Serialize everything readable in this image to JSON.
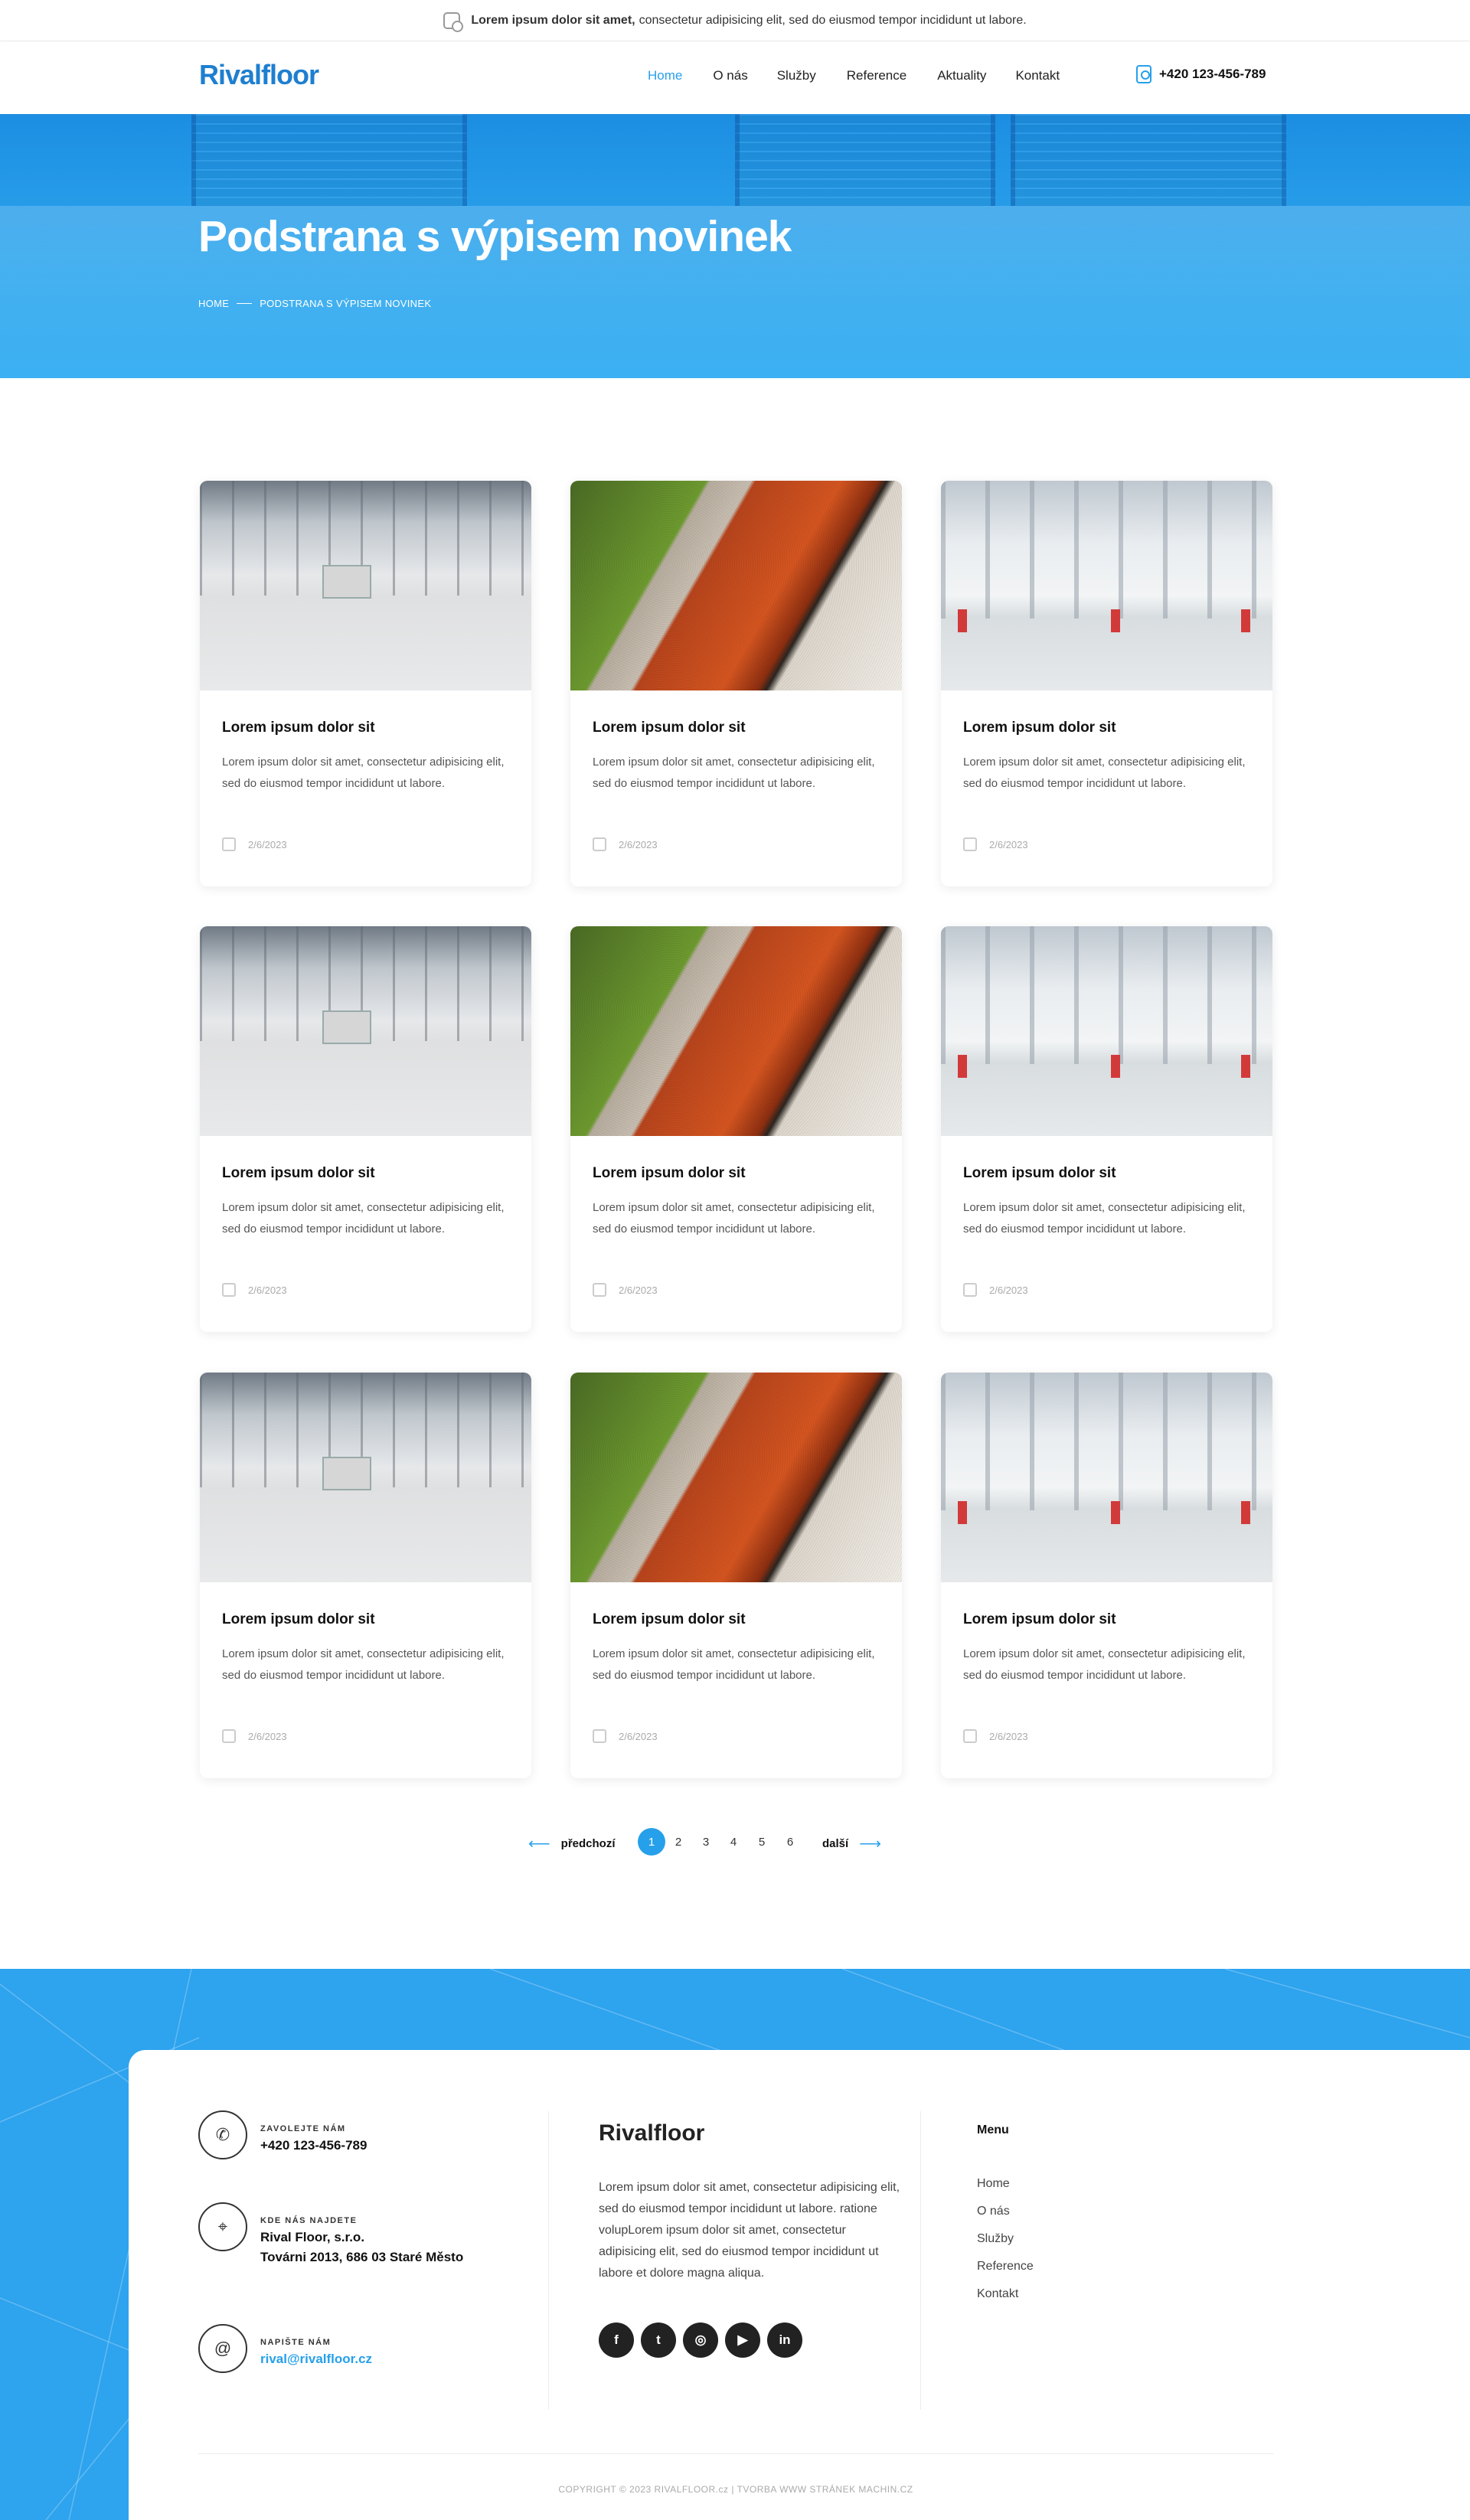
{
  "topbar": {
    "bold": "Lorem ipsum dolor sit amet,",
    "text": "consectetur adipisicing elit, sed do eiusmod tempor incididunt ut labore."
  },
  "header": {
    "logo": "Rivalfloor",
    "nav": [
      "Home",
      "O nás",
      "Služby",
      "Reference",
      "Aktuality",
      "Kontakt"
    ],
    "phone": "+420 123-456-789"
  },
  "hero": {
    "title": "Podstrana s výpisem novinek",
    "breadcrumb": [
      "HOME",
      "PODSTRANA S VÝPISEM NOVINEK"
    ]
  },
  "posts": [
    {
      "title": "Lorem ipsum dolor sit",
      "text": "Lorem ipsum dolor sit amet, consectetur adipisicing elit, sed do eiusmod tempor incididunt ut labore.",
      "date": "2/6/2023"
    },
    {
      "title": "Lorem ipsum dolor sit",
      "text": "Lorem ipsum dolor sit amet, consectetur adipisicing elit, sed do eiusmod tempor incididunt ut labore.",
      "date": "2/6/2023"
    },
    {
      "title": "Lorem ipsum dolor sit",
      "text": "Lorem ipsum dolor sit amet, consectetur adipisicing elit, sed do eiusmod tempor incididunt ut labore.",
      "date": "2/6/2023"
    },
    {
      "title": "Lorem ipsum dolor sit",
      "text": "Lorem ipsum dolor sit amet, consectetur adipisicing elit, sed do eiusmod tempor incididunt ut labore.",
      "date": "2/6/2023"
    },
    {
      "title": "Lorem ipsum dolor sit",
      "text": "Lorem ipsum dolor sit amet, consectetur adipisicing elit, sed do eiusmod tempor incididunt ut labore.",
      "date": "2/6/2023"
    },
    {
      "title": "Lorem ipsum dolor sit",
      "text": "Lorem ipsum dolor sit amet, consectetur adipisicing elit, sed do eiusmod tempor incididunt ut labore.",
      "date": "2/6/2023"
    },
    {
      "title": "Lorem ipsum dolor sit",
      "text": "Lorem ipsum dolor sit amet, consectetur adipisicing elit, sed do eiusmod tempor incididunt ut labore.",
      "date": "2/6/2023"
    },
    {
      "title": "Lorem ipsum dolor sit",
      "text": "Lorem ipsum dolor sit amet, consectetur adipisicing elit, sed do eiusmod tempor incididunt ut labore.",
      "date": "2/6/2023"
    },
    {
      "title": "Lorem ipsum dolor sit",
      "text": "Lorem ipsum dolor sit amet, consectetur adipisicing elit, sed do eiusmod tempor incididunt ut labore.",
      "date": "2/6/2023"
    }
  ],
  "pagination": {
    "prev": "předchozí",
    "next": "další",
    "pages": [
      "1",
      "2",
      "3",
      "4",
      "5",
      "6"
    ],
    "current": "1"
  },
  "footer": {
    "call_label": "ZAVOLEJTE NÁM",
    "call_value": "+420 123-456-789",
    "address_label": "KDE NÁS NAJDETE",
    "address_line1": "Rival Floor, s.r.o.",
    "address_line2": "Továrni 2013, 686 03 Staré Město",
    "mail_label": "NAPIŠTE NÁM",
    "mail_value": "rival@rivalfloor.cz",
    "brand": "Rivalfloor",
    "description": "Lorem ipsum dolor sit amet, consectetur adipisicing elit, sed do eiusmod tempor incididunt ut labore.  ratione volupLorem ipsum dolor sit amet, consectetur adipisicing elit, sed do eiusmod tempor incididunt ut labore et dolore magna aliqua.",
    "social": [
      "facebook-icon",
      "twitter-icon",
      "instagram-icon",
      "youtube-icon",
      "linkedin-icon"
    ],
    "menu_title": "Menu",
    "menu": [
      "Home",
      "O nás",
      "Služby",
      "Reference",
      "Kontakt"
    ],
    "copyright": "COPYRIGHT © 2023 RIVALFLOOR.cz  |  TVORBA WWW STRÁNEK MACHIN.CZ"
  },
  "colors": {
    "accent": "#26a0ea",
    "logo": "#1e7fd0",
    "footer_bg": "#2ea3ee"
  }
}
